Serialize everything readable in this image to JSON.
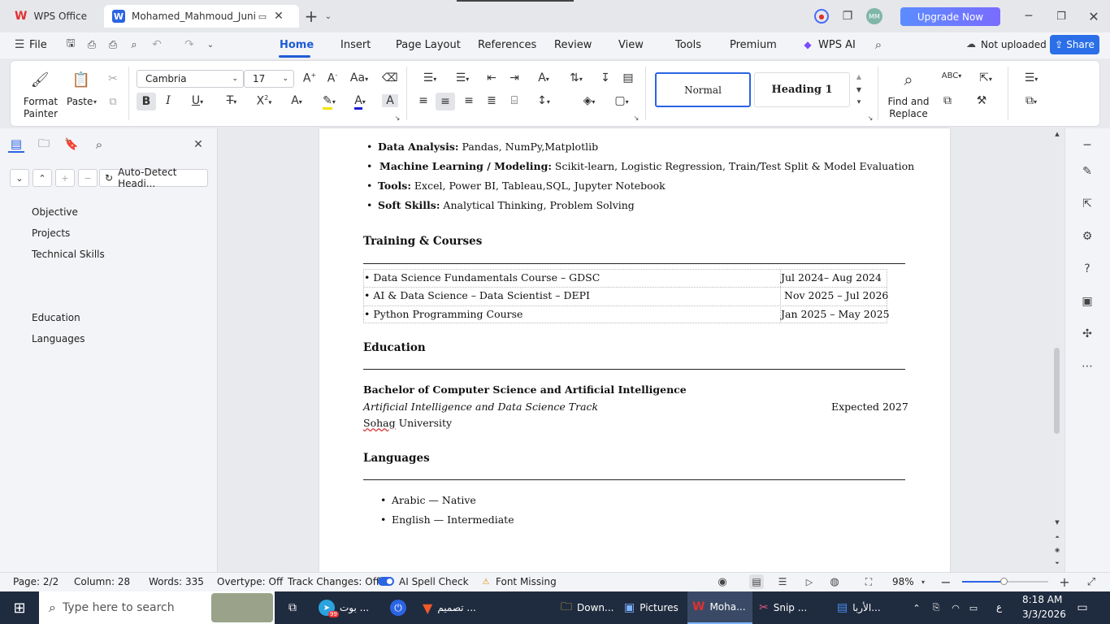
{
  "window": {
    "tabs": [
      {
        "label": "WPS Office"
      },
      {
        "label": "Mohamed_Mahmoud_Junior"
      }
    ],
    "upgrade_label": "Upgrade Now",
    "avatar_initials": "MM"
  },
  "menu": {
    "file": "File",
    "items": [
      "Home",
      "Insert",
      "Page Layout",
      "References",
      "Review",
      "View",
      "Tools",
      "Premium"
    ],
    "wps_ai": "WPS AI",
    "not_uploaded": "Not uploaded",
    "share": "Share"
  },
  "ribbon": {
    "format_painter": "Format\nPainter",
    "paste": "Paste",
    "font_name": "Cambria",
    "font_size": "17",
    "style_normal": "Normal",
    "style_heading1": "Heading 1",
    "find_replace": "Find and\nReplace"
  },
  "nav": {
    "autodetect": "Auto-Detect Headi...",
    "items": [
      "Objective",
      "Projects",
      "Technical Skills",
      "Education",
      "Languages"
    ]
  },
  "doc": {
    "skills": [
      {
        "label": "Data Analysis:",
        "text": " Pandas, NumPy,Matplotlib"
      },
      {
        "label": "Machine Learning / Modeling:",
        "text": " Scikit-learn, Logistic Regression, Train/Test Split & Model Evaluation"
      },
      {
        "label": "Tools:",
        "text": " Excel, Power BI, Tableau,SQL, Jupyter Notebook"
      },
      {
        "label": "Soft Skills:",
        "text": " Analytical Thinking, Problem Solving"
      }
    ],
    "training_heading": "Training & Courses",
    "courses": [
      {
        "name": "• Data  Science Fundamentals Course – GDSC",
        "date": "Jul 2024– Aug 2024"
      },
      {
        "name": "• AI & Data Science – Data Scientist – DEPI",
        "date": "Nov 2025 – Jul 2026"
      },
      {
        "name": "• Python Programming Course",
        "date": "Jan 2025 – May 2025"
      }
    ],
    "education_heading": "Education",
    "degree": "Bachelor of Computer Science and Artificial Intelligence",
    "track": "Artificial Intelligence and Data Science Track",
    "expected": "Expected 2027",
    "university_name": "Sohag",
    "university_rest": " University",
    "languages_heading": "Languages",
    "languages": [
      "Arabic — Native",
      "English — Intermediate"
    ]
  },
  "status": {
    "page": "Page: 2/2",
    "column": "Column: 28",
    "words": "Words: 335",
    "overtype": "Overtype: Off",
    "track": "Track Changes: Off",
    "spell": "AI Spell Check",
    "font_missing": "Font Missing",
    "zoom": "98%"
  },
  "taskbar": {
    "search_placeholder": "Type here to search",
    "badge": "99",
    "apps": [
      "بوت ...",
      "تصميم ...",
      "Down...",
      "Pictures",
      "Moha...",
      "Snip ...",
      "الأربا..."
    ],
    "time": "8:18 AM",
    "date": "3/3/2026",
    "lang": "ع"
  }
}
